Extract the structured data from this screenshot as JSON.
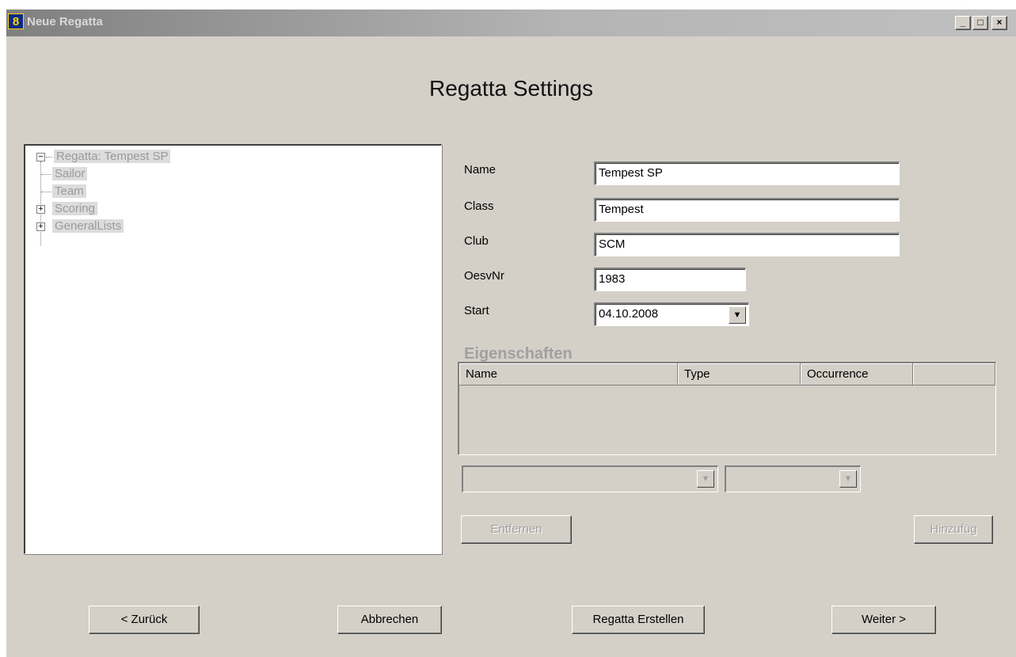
{
  "window": {
    "title": "Neue Regatta",
    "icon": "8",
    "controls": {
      "minimize": "_",
      "maximize": "□",
      "close": "×"
    }
  },
  "page_title": "Regatta Settings",
  "tree": {
    "root": "Regatta: Tempest SP",
    "children": [
      "Sailor",
      "Team",
      "Scoring",
      "GeneralLists"
    ],
    "root_expander": "−",
    "child_expander": "+"
  },
  "form": {
    "name": {
      "label": "Name",
      "value": "Tempest SP"
    },
    "class": {
      "label": "Class",
      "value": "Tempest"
    },
    "club": {
      "label": "Club",
      "value": "SCM"
    },
    "oesvnr": {
      "label": "OesvNr",
      "value": "1983"
    },
    "start": {
      "label": "Start",
      "value": "04.10.2008"
    }
  },
  "properties": {
    "heading": "Eigenschaften",
    "columns": [
      "Name",
      "Type",
      "Occurrence",
      ""
    ]
  },
  "buttons": {
    "remove": "Entfernen",
    "add": "Hinzufüg",
    "back": "< Zurück",
    "cancel": "Abbrechen",
    "create": "Regatta Erstellen",
    "next": "Weiter >"
  },
  "colors": {
    "window_bg": "#d4d0c8",
    "disabled_text": "#a0a0a0"
  }
}
